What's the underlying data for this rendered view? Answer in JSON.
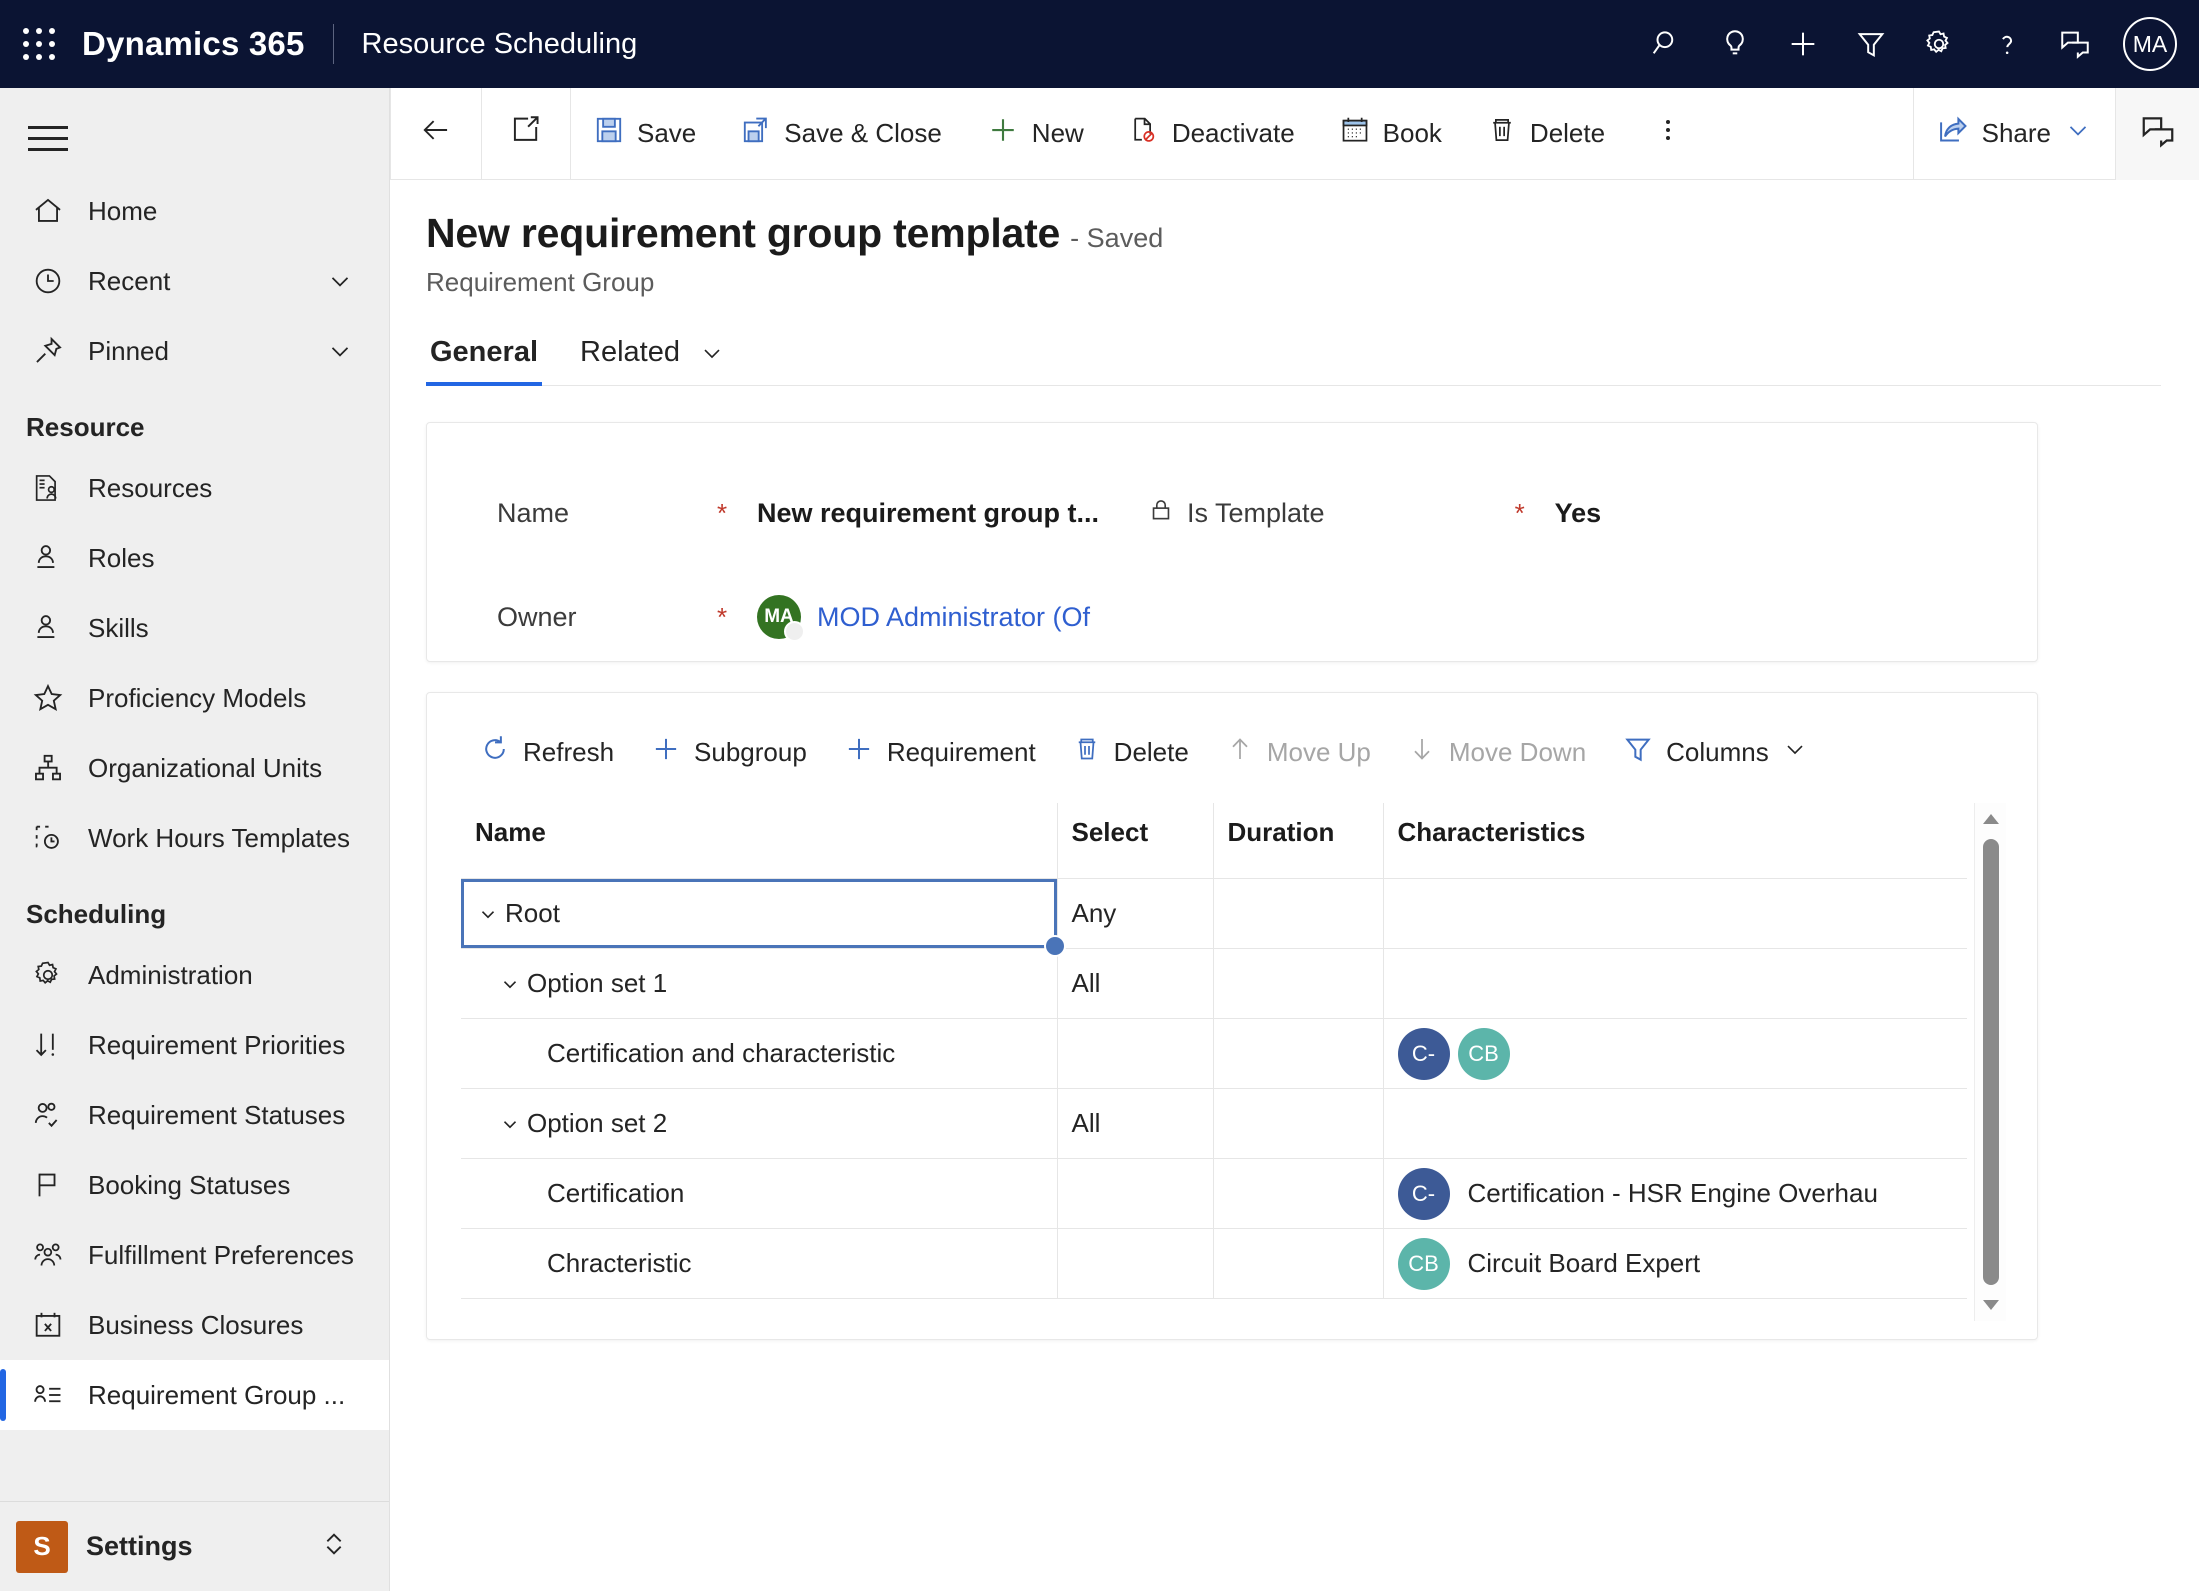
{
  "appbar": {
    "waffle_icon": "app-launcher-icon",
    "brand": "Dynamics 365",
    "app_name": "Resource Scheduling",
    "icons": [
      {
        "name": "search-icon",
        "label": "Search"
      },
      {
        "name": "lightbulb-icon",
        "label": "Insights"
      },
      {
        "name": "plus-icon",
        "label": "New"
      },
      {
        "name": "filter-icon",
        "label": "Filter"
      },
      {
        "name": "gear-icon",
        "label": "Settings"
      },
      {
        "name": "question-icon",
        "label": "Help"
      },
      {
        "name": "feedback-icon",
        "label": "Feedback"
      }
    ],
    "avatar_initials": "MA"
  },
  "sidebar": {
    "hamburger_label": "Site Map",
    "top_items": [
      {
        "label": "Home",
        "icon": "home-icon",
        "chevron": false
      },
      {
        "label": "Recent",
        "icon": "clock-icon",
        "chevron": true
      },
      {
        "label": "Pinned",
        "icon": "pin-icon",
        "chevron": true
      }
    ],
    "groups": [
      {
        "title": "Resource",
        "items": [
          {
            "label": "Resources",
            "icon": "resource-card-icon"
          },
          {
            "label": "Roles",
            "icon": "person-line-icon"
          },
          {
            "label": "Skills",
            "icon": "person-line-icon"
          },
          {
            "label": "Proficiency Models",
            "icon": "star-icon"
          },
          {
            "label": "Organizational Units",
            "icon": "org-chart-icon"
          },
          {
            "label": "Work Hours Templates",
            "icon": "clock-dashed-icon"
          }
        ]
      },
      {
        "title": "Scheduling",
        "items": [
          {
            "label": "Administration",
            "icon": "gear-icon"
          },
          {
            "label": "Requirement Priorities",
            "icon": "sort-priority-icon"
          },
          {
            "label": "Requirement Statuses",
            "icon": "people-check-icon"
          },
          {
            "label": "Booking Statuses",
            "icon": "flag-icon"
          },
          {
            "label": "Fulfillment Preferences",
            "icon": "people-group-icon"
          },
          {
            "label": "Business Closures",
            "icon": "calendar-x-icon"
          },
          {
            "label": "Requirement Group ...",
            "icon": "person-list-icon",
            "selected": true
          }
        ]
      }
    ],
    "footer": {
      "tile_letter": "S",
      "label": "Settings",
      "chevron_icon": "chevron-updown-icon"
    }
  },
  "commandbar": {
    "back_icon": "back-arrow-icon",
    "popout_icon": "open-in-new-icon",
    "buttons": [
      {
        "label": "Save",
        "icon": "save-icon"
      },
      {
        "label": "Save & Close",
        "icon": "save-close-icon"
      },
      {
        "label": "New",
        "icon": "plus-icon"
      },
      {
        "label": "Deactivate",
        "icon": "deactivate-icon"
      },
      {
        "label": "Book",
        "icon": "calendar-icon"
      },
      {
        "label": "Delete",
        "icon": "trash-icon"
      }
    ],
    "overflow_icon": "more-vertical-icon",
    "share": {
      "label": "Share",
      "icon": "share-icon",
      "chevron_icon": "chevron-down-icon"
    },
    "right_panel_icon": "chat-panel-icon"
  },
  "page": {
    "title": "New requirement group template",
    "saved_state": "- Saved",
    "subtitle": "Requirement Group",
    "tabs": [
      {
        "label": "General",
        "active": true,
        "chevron": false
      },
      {
        "label": "Related",
        "active": false,
        "chevron": true
      }
    ]
  },
  "form": {
    "name": {
      "label": "Name",
      "required": "*",
      "value": "New requirement group t..."
    },
    "is_template": {
      "label": "Is Template",
      "lock_icon": "lock-icon",
      "required": "*",
      "value": "Yes"
    },
    "owner": {
      "label": "Owner",
      "required": "*",
      "avatar_initials": "MA",
      "value": "MOD Administrator (Of"
    }
  },
  "grid": {
    "toolbar": [
      {
        "label": "Refresh",
        "icon": "refresh-icon",
        "disabled": false
      },
      {
        "label": "Subgroup",
        "icon": "plus-icon",
        "disabled": false
      },
      {
        "label": "Requirement",
        "icon": "plus-icon",
        "disabled": false
      },
      {
        "label": "Delete",
        "icon": "trash-icon",
        "disabled": false
      },
      {
        "label": "Move Up",
        "icon": "arrow-up-icon",
        "disabled": true
      },
      {
        "label": "Move Down",
        "icon": "arrow-down-icon",
        "disabled": true
      },
      {
        "label": "Columns",
        "icon": "filter-icon",
        "disabled": false,
        "chevron": true
      }
    ],
    "columns": [
      "Name",
      "Select",
      "Duration",
      "Characteristics"
    ],
    "rows": [
      {
        "name": "Root",
        "indent": 0,
        "twisty": true,
        "select": "Any",
        "duration": "",
        "characteristics": [],
        "char_text": "",
        "selected": true
      },
      {
        "name": "Option set 1",
        "indent": 1,
        "twisty": true,
        "select": "All",
        "duration": "",
        "characteristics": [],
        "char_text": "",
        "selected": false
      },
      {
        "name": "Certification and characteristic",
        "indent": 2,
        "twisty": false,
        "select": "",
        "duration": "",
        "characteristics": [
          {
            "initials": "C-",
            "color": "#3d5a96"
          },
          {
            "initials": "CB",
            "color": "#5cb5aa"
          }
        ],
        "char_text": "",
        "selected": false
      },
      {
        "name": "Option set 2",
        "indent": 1,
        "twisty": true,
        "select": "All",
        "duration": "",
        "characteristics": [],
        "char_text": "",
        "selected": false
      },
      {
        "name": "Certification",
        "indent": 2,
        "twisty": false,
        "select": "",
        "duration": "",
        "characteristics": [
          {
            "initials": "C-",
            "color": "#3d5a96"
          }
        ],
        "char_text": "Certification - HSR Engine Overhau",
        "selected": false
      },
      {
        "name": "Chracteristic",
        "indent": 2,
        "twisty": false,
        "select": "",
        "duration": "",
        "characteristics": [
          {
            "initials": "CB",
            "color": "#5cb5aa"
          }
        ],
        "char_text": "Circuit Board Expert",
        "selected": false
      }
    ],
    "scrollbar": {
      "up_icon": "triangle-up-icon",
      "down_icon": "triangle-down-icon"
    }
  },
  "colors": {
    "appbar_bg": "#0b1433",
    "accent": "#2266e3",
    "required_star": "#c0392b",
    "link": "#2f5fd0",
    "chip_blue": "#3d5a96",
    "chip_teal": "#5cb5aa",
    "owner_avatar": "#337322",
    "settings_tile": "#bf5a16"
  }
}
